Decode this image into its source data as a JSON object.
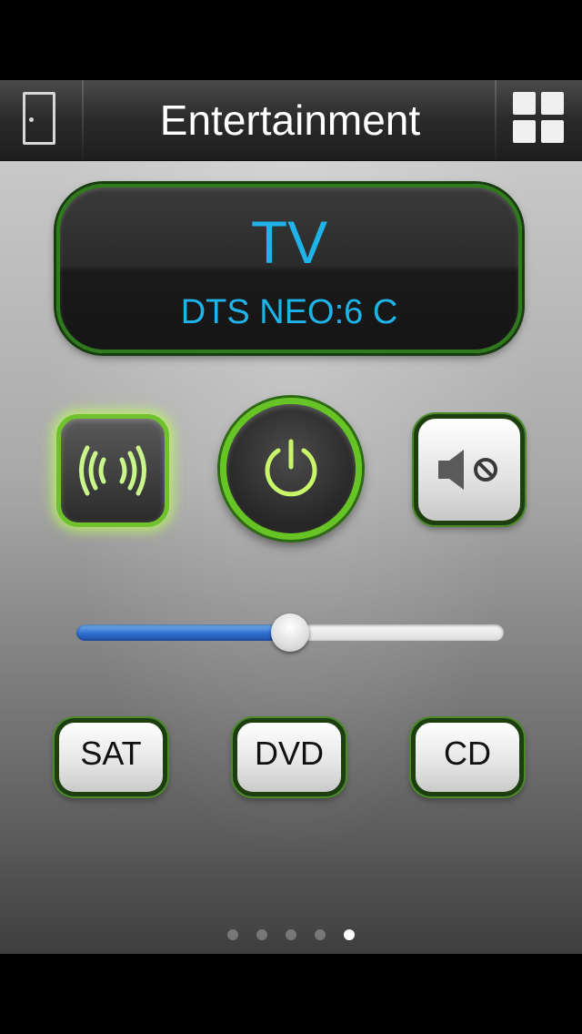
{
  "header": {
    "title": "Entertainment",
    "left_icon": "door-icon",
    "right_icon": "grid-icon"
  },
  "display": {
    "source": "TV",
    "mode": "DTS NEO:6 C",
    "text_color": "#1eb4ea"
  },
  "controls": {
    "wireless_icon": "wireless-icon",
    "power_icon": "power-icon",
    "mute_icon": "mute-icon",
    "accent_color": "#66c424"
  },
  "volume": {
    "level": 0.5
  },
  "sources": [
    {
      "label": "SAT"
    },
    {
      "label": "DVD"
    },
    {
      "label": "CD"
    }
  ],
  "pager": {
    "count": 5,
    "active": 4
  }
}
